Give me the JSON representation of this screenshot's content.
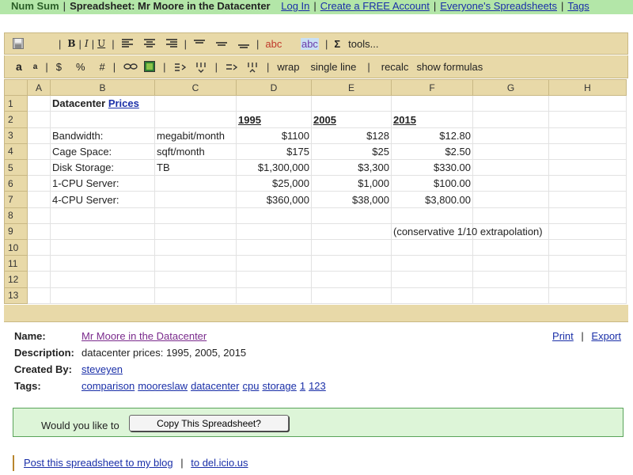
{
  "topbar": {
    "brand": "Num Sum",
    "title": "Spreadsheet: Mr Moore in the Datacenter",
    "links": [
      "Log In",
      "Create a FREE Account",
      "Everyone's Spreadsheets",
      "Tags"
    ]
  },
  "toolbar": {
    "bold": "B",
    "italic": "I",
    "underline": "U",
    "text_color": "abc",
    "bg_color": "abc",
    "sigma": "Σ",
    "tools": "tools...",
    "larger": "a",
    "smaller": "a",
    "currency": "$",
    "percent": "%",
    "number": "#",
    "wrap": "wrap",
    "single_line": "single line",
    "recalc": "recalc",
    "show_formulas": "show formulas"
  },
  "sheet": {
    "columns": [
      "A",
      "B",
      "C",
      "D",
      "E",
      "F",
      "G",
      "H"
    ],
    "rows": [
      {
        "n": "1",
        "B": "Datacenter ",
        "B_link": "Prices",
        "C": "",
        "D": "",
        "E": "",
        "F": ""
      },
      {
        "n": "2",
        "B": "",
        "C": "",
        "D": "1995",
        "E": "2005",
        "F": "2015"
      },
      {
        "n": "3",
        "B": "Bandwidth:",
        "C": "megabit/month",
        "D": "$1100",
        "E": "$128",
        "F": "$12.80"
      },
      {
        "n": "4",
        "B": "Cage Space:",
        "C": "sqft/month",
        "D": "$175",
        "E": "$25",
        "F": "$2.50"
      },
      {
        "n": "5",
        "B": "Disk Storage:",
        "C": "TB",
        "D": "$1,300,000",
        "E": "$3,300",
        "F": "$330.00"
      },
      {
        "n": "6",
        "B": "1-CPU Server:",
        "C": "",
        "D": "$25,000",
        "E": "$1,000",
        "F": "$100.00"
      },
      {
        "n": "7",
        "B": "4-CPU Server:",
        "C": "",
        "D": "$360,000",
        "E": "$38,000",
        "F": "$3,800.00"
      },
      {
        "n": "8",
        "B": "",
        "C": "",
        "D": "",
        "E": "",
        "F": ""
      },
      {
        "n": "9",
        "B": "",
        "C": "",
        "D": "",
        "E": "",
        "F": "(conservative 1/10 extrapolation)"
      },
      {
        "n": "10",
        "B": "",
        "C": "",
        "D": "",
        "E": "",
        "F": ""
      },
      {
        "n": "11",
        "B": "",
        "C": "",
        "D": "",
        "E": "",
        "F": ""
      },
      {
        "n": "12",
        "B": "",
        "C": "",
        "D": "",
        "E": "",
        "F": ""
      },
      {
        "n": "13",
        "B": "",
        "C": "",
        "D": "",
        "E": "",
        "F": ""
      }
    ]
  },
  "meta": {
    "name_label": "Name:",
    "name": "Mr Moore in the Datacenter",
    "desc_label": "Description:",
    "desc": "datacenter prices: 1995, 2005, 2015",
    "created_label": "Created By:",
    "created": "steveyen",
    "tags_label": "Tags:",
    "tags": [
      "comparison",
      "mooreslaw",
      "datacenter",
      "cpu",
      "storage",
      "1",
      "123"
    ],
    "print": "Print",
    "export": "Export",
    "sep": "|"
  },
  "copy": {
    "prompt": "Would you like to",
    "button": "Copy This Spreadsheet?"
  },
  "footer": {
    "post": "Post this spreadsheet to my blog",
    "sep": "|",
    "delicious": "to del.icio.us"
  },
  "colors": {
    "green_bar": "#b3e6a8",
    "toolbar": "#e8d9a8",
    "copy_bg": "#ddf5d8",
    "link": "#1a2fa8",
    "visited": "#7a2a8c"
  }
}
